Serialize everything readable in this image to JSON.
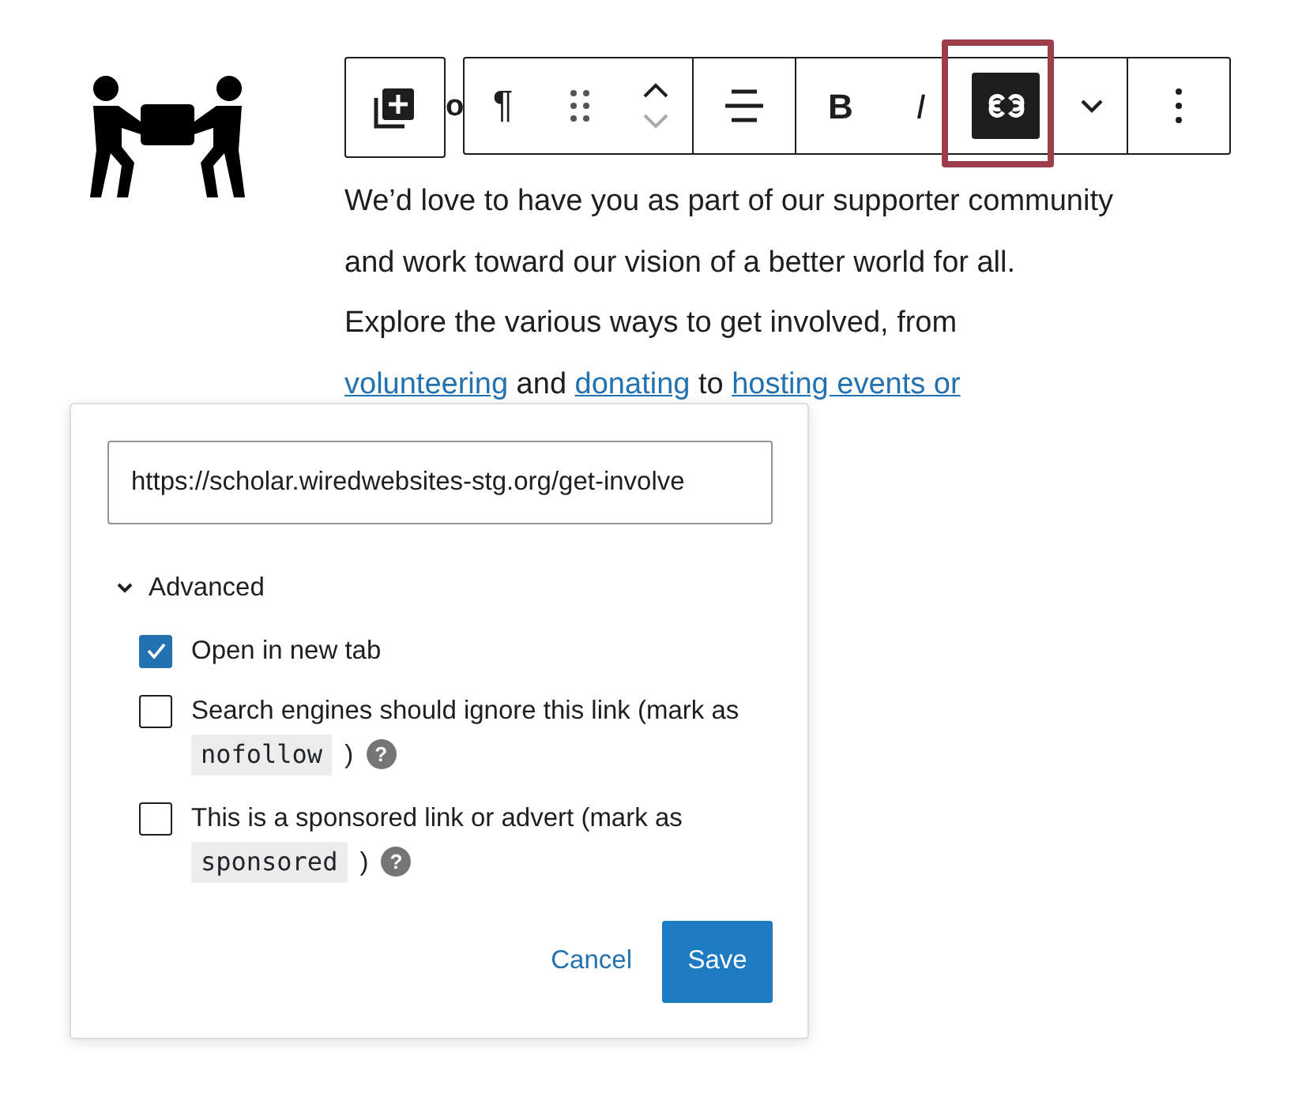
{
  "heading_fragment": "o",
  "toolbar": {
    "paragraph_glyph": "¶",
    "bold_label": "B",
    "italic_label": "I",
    "link_active": true,
    "link_highlighted": true
  },
  "paragraph": {
    "lines": [
      [
        {
          "text": "We’d love to have you as part of our supporter community",
          "kind": "text"
        }
      ],
      [
        {
          "text": "and work toward our vision of a better world for all.",
          "kind": "text"
        }
      ],
      [
        {
          "text": "Explore the various ways to get involved, from",
          "kind": "text"
        }
      ],
      [
        {
          "text": "volunteering",
          "kind": "link"
        },
        {
          "text": " and ",
          "kind": "text"
        },
        {
          "text": "donating",
          "kind": "link"
        },
        {
          "text": " to ",
          "kind": "text"
        },
        {
          "text": "hosting events or ",
          "kind": "link"
        }
      ]
    ]
  },
  "link_popover": {
    "url": "https://scholar.wiredwebsites-stg.org/get-involve",
    "advanced": {
      "label": "Advanced",
      "expanded": true
    },
    "options": [
      {
        "text": "Open in new tab",
        "checked": true
      },
      {
        "text": "Search engines should ignore this link (mark as",
        "code": "nofollow",
        "suffix": ")",
        "help": "?",
        "checked": false
      },
      {
        "text": "This is a sponsored link or advert (mark as",
        "code": "sponsored",
        "suffix": ")",
        "help": "?",
        "checked": false
      }
    ],
    "buttons": [
      {
        "label": "Cancel",
        "kind": "link"
      },
      {
        "label": "Save",
        "kind": "primary"
      }
    ]
  }
}
